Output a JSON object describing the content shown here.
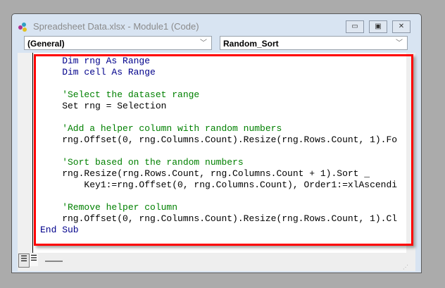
{
  "window": {
    "title": "Spreadsheet Data.xlsx - Module1 (Code)",
    "minimize": "▭",
    "restore": "▣",
    "close": "✕"
  },
  "object_dropdown": {
    "value": "(General)"
  },
  "procedure_dropdown": {
    "value": "Random_Sort"
  },
  "code_lines": [
    {
      "kind": "kw",
      "text": "    Dim rng As Range"
    },
    {
      "kind": "kw",
      "text": "    Dim cell As Range"
    },
    {
      "kind": "tx",
      "text": ""
    },
    {
      "kind": "cm",
      "text": "    'Select the dataset range"
    },
    {
      "kind": "tx",
      "text": "    Set rng = Selection"
    },
    {
      "kind": "tx",
      "text": ""
    },
    {
      "kind": "cm",
      "text": "    'Add a helper column with random numbers"
    },
    {
      "kind": "tx",
      "text": "    rng.Offset(0, rng.Columns.Count).Resize(rng.Rows.Count, 1).Fo"
    },
    {
      "kind": "tx",
      "text": ""
    },
    {
      "kind": "cm",
      "text": "    'Sort based on the random numbers"
    },
    {
      "kind": "tx",
      "text": "    rng.Resize(rng.Rows.Count, rng.Columns.Count + 1).Sort _"
    },
    {
      "kind": "tx",
      "text": "        Key1:=rng.Offset(0, rng.Columns.Count), Order1:=xlAscendi"
    },
    {
      "kind": "tx",
      "text": ""
    },
    {
      "kind": "cm",
      "text": "    'Remove helper column"
    },
    {
      "kind": "tx",
      "text": "    rng.Offset(0, rng.Columns.Count).Resize(rng.Rows.Count, 1).Cl"
    },
    {
      "kind": "kw",
      "text": "End Sub"
    }
  ]
}
